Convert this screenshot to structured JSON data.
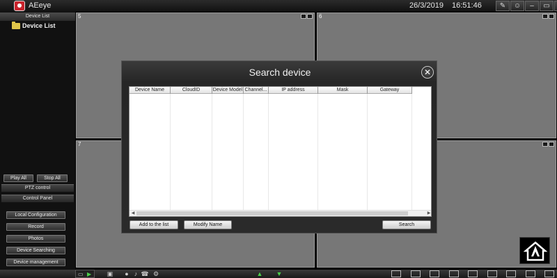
{
  "app": {
    "title": "AEeye",
    "date": "26/3/2019",
    "time": "16:51:46"
  },
  "titlebar_icons": [
    "edit-icon",
    "user-icon",
    "minimize-icon",
    "restore-icon",
    "close-icon"
  ],
  "sidebar": {
    "header": "Device List",
    "tree_root": "Device List",
    "play_all": "Play All",
    "stop_all": "Stop All",
    "ptz_control": "PTZ control",
    "control_panel": "Control Panel",
    "menu": [
      "Local Configuration",
      "Record",
      "Photos",
      "Device Searching",
      "Device management"
    ]
  },
  "grid": {
    "cells": [
      {
        "label": "5"
      },
      {
        "label": "6"
      },
      {
        "label": "7"
      },
      {
        "label": ""
      }
    ]
  },
  "dialog": {
    "title": "Search device",
    "columns": [
      "Device Name",
      "CloudID",
      "Device Model",
      "Channel...",
      "IP address",
      "Mask",
      "Gateway"
    ],
    "buttons": {
      "add": "Add to the list",
      "modify": "Modify Name",
      "search": "Search"
    }
  },
  "colors": {
    "accent": "#c8232c",
    "cell_bg": "#777777",
    "dialog_bg": "#2a2a2a"
  }
}
